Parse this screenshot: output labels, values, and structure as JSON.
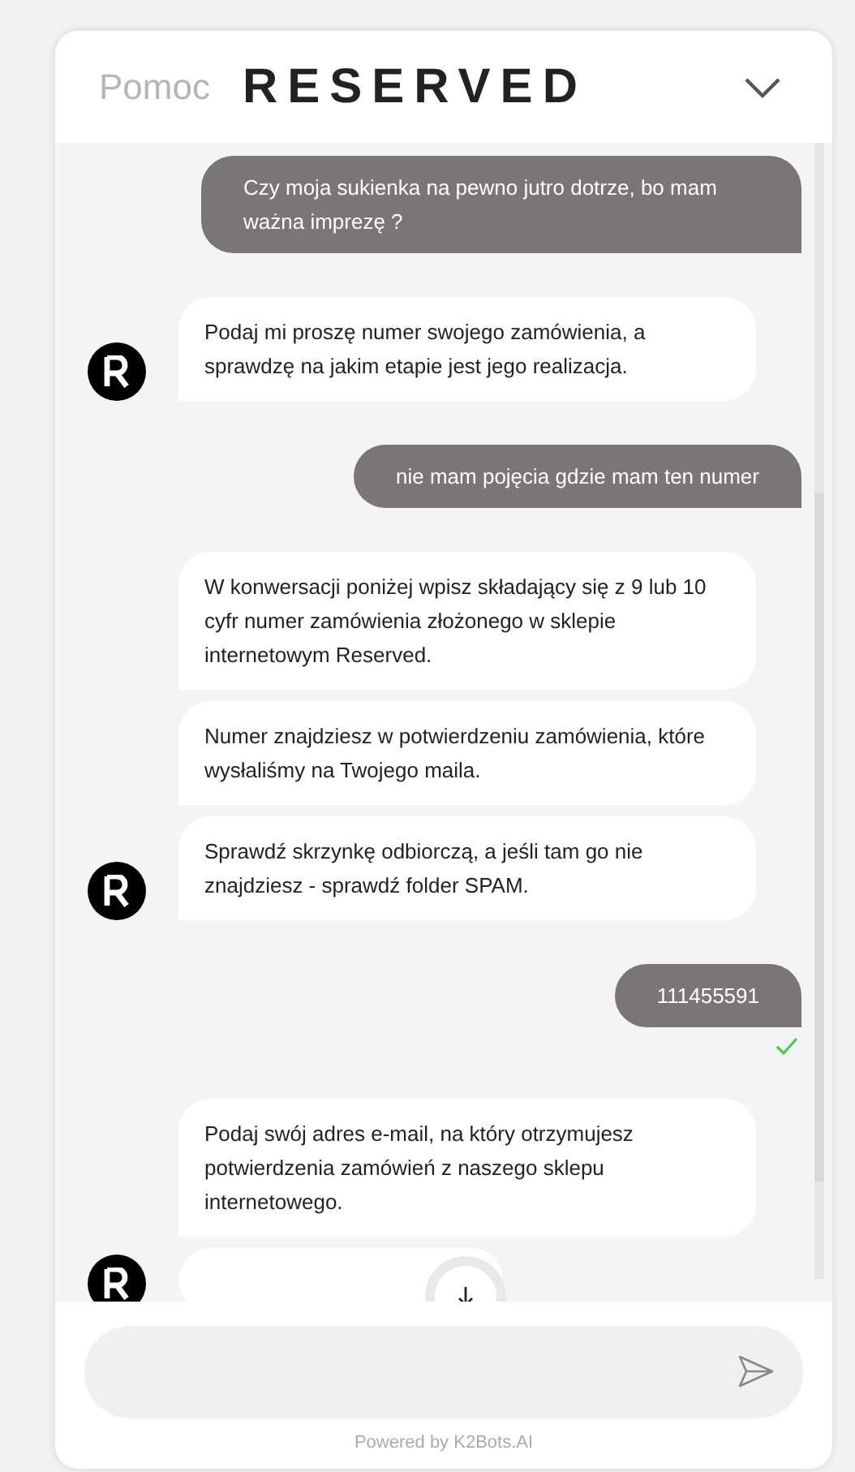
{
  "header": {
    "label": "Pomoc",
    "brand": "RESERVED"
  },
  "messages": [
    {
      "kind": "user",
      "text": "Czy moja sukienka na pewno jutro dotrze, bo mam ważna imprezę ?"
    },
    {
      "kind": "bot",
      "bubbles": [
        "Podaj mi proszę numer swojego zamówienia, a sprawdzę na jakim etapie jest jego realizacja."
      ]
    },
    {
      "kind": "user",
      "text": "nie mam pojęcia gdzie mam ten numer"
    },
    {
      "kind": "bot",
      "bubbles": [
        "W konwersacji poniżej wpisz składający się z 9 lub 10 cyfr numer zamówienia złożonego w sklepie internetowym Reserved.",
        "Numer znajdziesz w potwierdzeniu zamówienia, które wysłaliśmy na Twojego maila.",
        "Sprawdź skrzynkę odbiorczą, a jeśli tam go nie znajdziesz - sprawdź folder SPAM."
      ]
    },
    {
      "kind": "user",
      "text": "111455591",
      "delivered": true
    },
    {
      "kind": "bot",
      "bubbles": [
        "Podaj swój adres e-mail, na który otrzymujesz potwierdzenia zamówień z naszego sklepu internetowego."
      ],
      "more_below": true
    }
  ],
  "footer": "Powered by K2Bots.AI"
}
